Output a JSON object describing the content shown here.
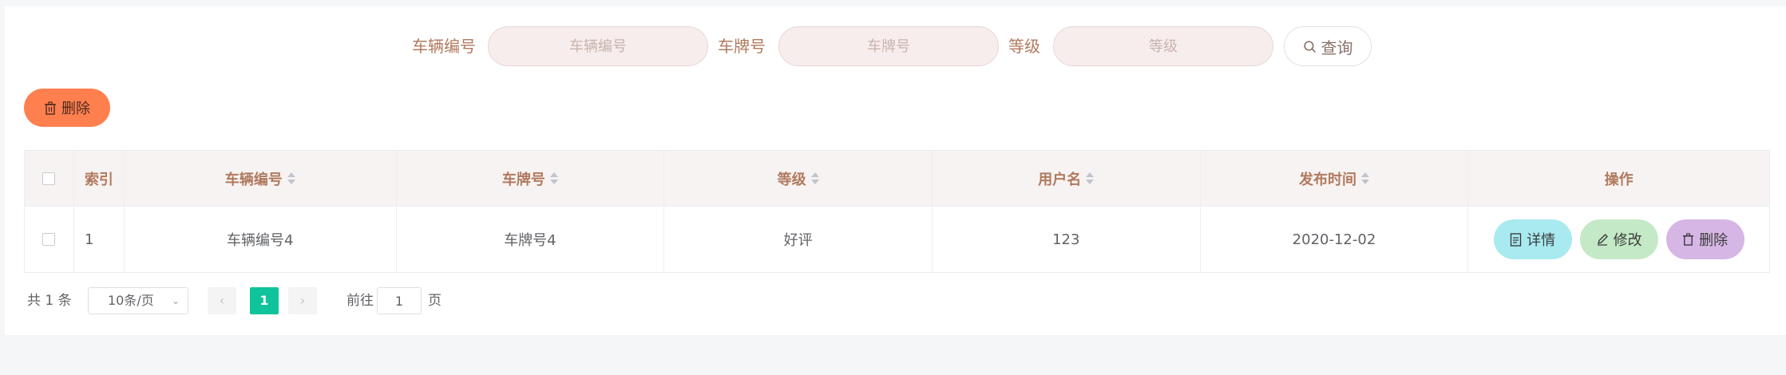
{
  "search": {
    "fields": [
      {
        "label": "车辆编号",
        "placeholder": "车辆编号",
        "value": ""
      },
      {
        "label": "车牌号",
        "placeholder": "车牌号",
        "value": ""
      },
      {
        "label": "等级",
        "placeholder": "等级",
        "value": ""
      }
    ],
    "query_label": "查询",
    "query_icon": "search-icon"
  },
  "toolbar": {
    "delete_label": "删除",
    "delete_icon": "trash-icon",
    "delete_color": "#ff7f4f"
  },
  "table": {
    "columns": [
      "",
      "索引",
      "车辆编号",
      "车牌号",
      "等级",
      "用户名",
      "发布时间",
      "操作"
    ],
    "rows": [
      {
        "index": "1",
        "vehicle_no": "车辆编号4",
        "plate_no": "车牌号4",
        "grade": "好评",
        "username": "123",
        "publish_time": "2020-12-02"
      }
    ],
    "row_actions": {
      "detail": "详情",
      "edit": "修改",
      "delete": "删除"
    },
    "action_colors": {
      "detail": "#a8eaf0",
      "edit": "#c4e9c6",
      "delete": "#d6b6e4"
    }
  },
  "pagination": {
    "total_text": "共 1 条",
    "page_size": "10条/页",
    "current_page": "1",
    "goto_label": "前往",
    "goto_value": "1",
    "page_suffix": "页",
    "active_color": "#0fc39a"
  }
}
